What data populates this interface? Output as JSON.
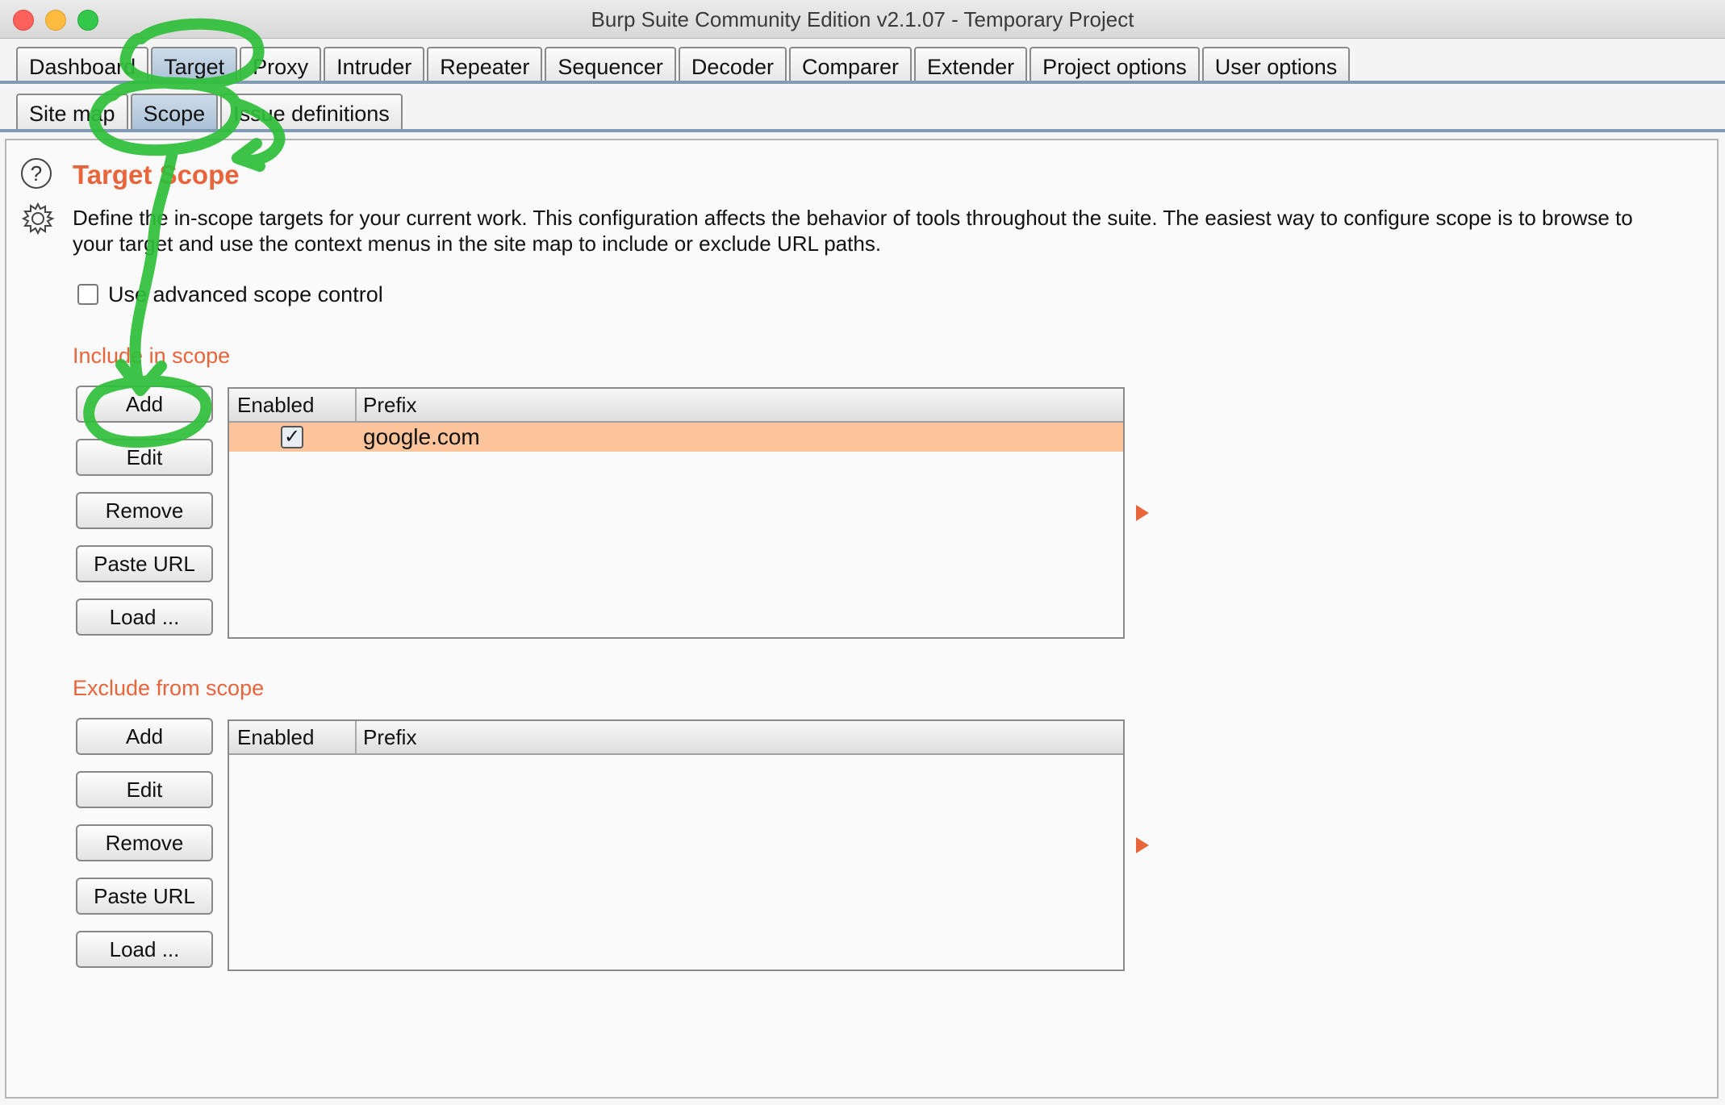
{
  "window": {
    "title": "Burp Suite Community Edition v2.1.07 - Temporary Project"
  },
  "main_tabs": [
    {
      "label": "Dashboard",
      "active": false
    },
    {
      "label": "Target",
      "active": true
    },
    {
      "label": "Proxy",
      "active": false
    },
    {
      "label": "Intruder",
      "active": false
    },
    {
      "label": "Repeater",
      "active": false
    },
    {
      "label": "Sequencer",
      "active": false
    },
    {
      "label": "Decoder",
      "active": false
    },
    {
      "label": "Comparer",
      "active": false
    },
    {
      "label": "Extender",
      "active": false
    },
    {
      "label": "Project options",
      "active": false
    },
    {
      "label": "User options",
      "active": false
    }
  ],
  "sub_tabs": [
    {
      "label": "Site map",
      "active": false
    },
    {
      "label": "Scope",
      "active": true
    },
    {
      "label": "Issue definitions",
      "active": false
    }
  ],
  "scope": {
    "help_icon_glyph": "?",
    "title": "Target Scope",
    "description": "Define the in-scope targets for your current work. This configuration affects the behavior of tools throughout the suite. The easiest way to configure scope is to browse to your target and use the context menus in the site map to include or exclude URL paths.",
    "advanced_label": "Use advanced scope control",
    "advanced_checked": false
  },
  "include": {
    "label": "Include in scope",
    "buttons": {
      "add": "Add",
      "edit": "Edit",
      "remove": "Remove",
      "paste": "Paste URL",
      "load": "Load ..."
    },
    "columns": {
      "enabled": "Enabled",
      "prefix": "Prefix"
    },
    "rows": [
      {
        "enabled_glyph": "✓",
        "prefix": "google.com"
      }
    ]
  },
  "exclude": {
    "label": "Exclude from scope",
    "buttons": {
      "add": "Add",
      "edit": "Edit",
      "remove": "Remove",
      "paste": "Paste URL",
      "load": "Load ..."
    },
    "columns": {
      "enabled": "Enabled",
      "prefix": "Prefix"
    },
    "rows": []
  },
  "colors": {
    "accent_orange": "#e8643a",
    "selected_row": "#fcc49a",
    "active_tab": "#a9c0d6",
    "annotation_green": "#2fbf3a"
  }
}
